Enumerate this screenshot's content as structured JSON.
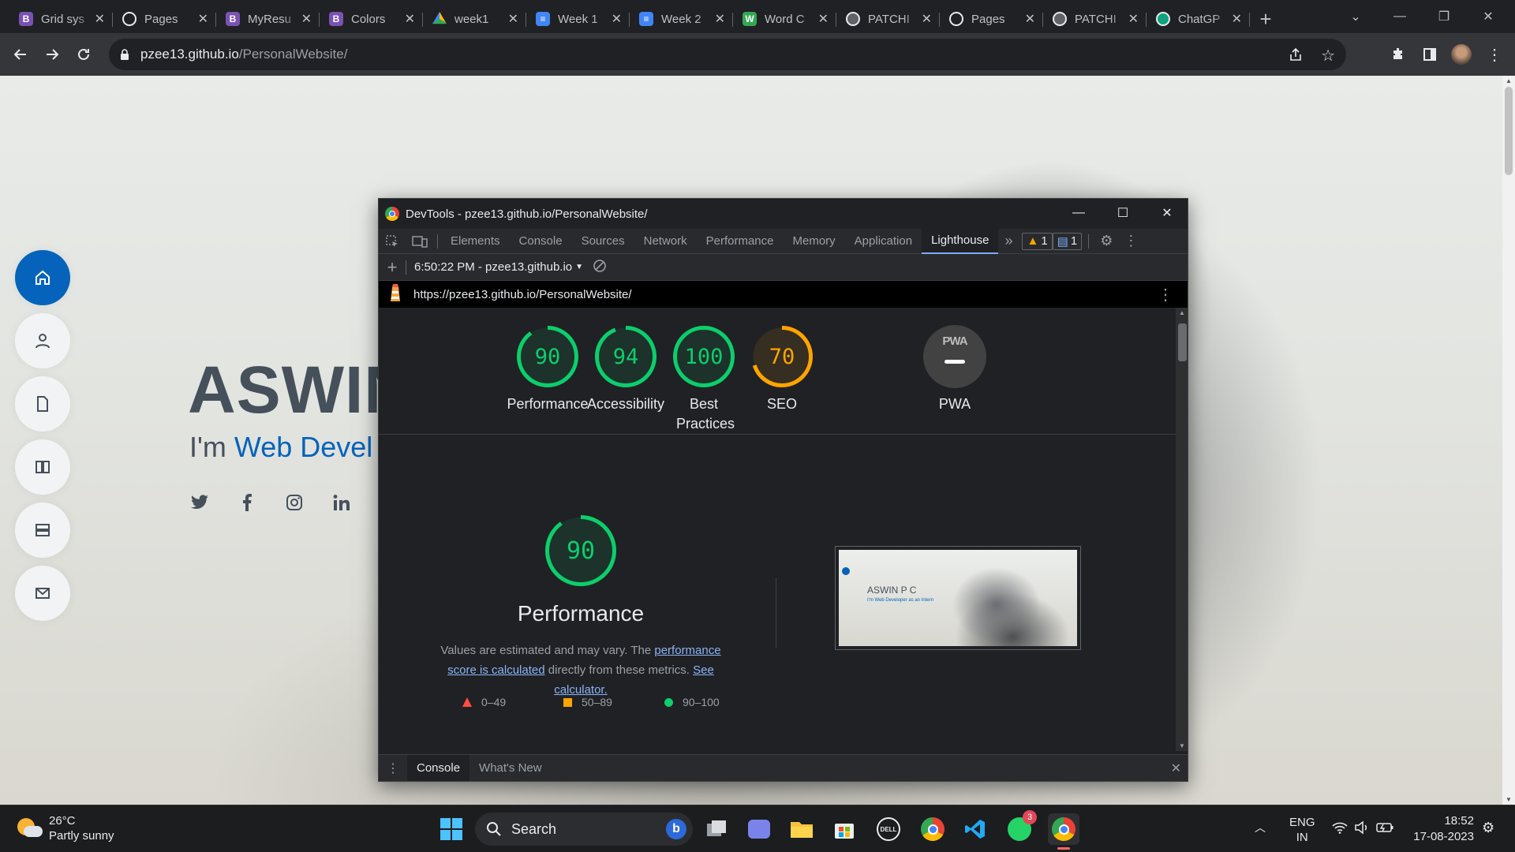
{
  "browser": {
    "tabs": [
      {
        "title": "Grid sys",
        "icon": "bootstrap-icon",
        "fav_color": "#7952b3",
        "fav_text": "B"
      },
      {
        "title": "Pages",
        "icon": "github-icon",
        "fav_color": "#202124",
        "fav_text": ""
      },
      {
        "title": "MyResu",
        "icon": "bootstrap-icon",
        "fav_color": "#7952b3",
        "fav_text": "B"
      },
      {
        "title": "Colors",
        "icon": "bootstrap-icon",
        "fav_color": "#7952b3",
        "fav_text": "B"
      },
      {
        "title": "week1",
        "icon": "google-drive-icon",
        "fav_color": "#202124",
        "fav_text": ""
      },
      {
        "title": "Week 1",
        "icon": "google-docs-icon",
        "fav_color": "#4285f4",
        "fav_text": "≡"
      },
      {
        "title": "Week 2",
        "icon": "google-docs-icon",
        "fav_color": "#4285f4",
        "fav_text": "≡"
      },
      {
        "title": "Word C",
        "icon": "word-counter-icon",
        "fav_color": "#34a853",
        "fav_text": "W"
      },
      {
        "title": "PATCHI",
        "icon": "globe-icon",
        "fav_color": "#5f6368",
        "fav_text": ""
      },
      {
        "title": "Pages",
        "icon": "github-icon",
        "fav_color": "#202124",
        "fav_text": ""
      },
      {
        "title": "PATCHI",
        "icon": "globe-icon",
        "fav_color": "#5f6368",
        "fav_text": ""
      },
      {
        "title": "ChatGP",
        "icon": "chatgpt-icon",
        "fav_color": "#10a37f",
        "fav_text": ""
      }
    ],
    "url_host": "pzee13.github.io",
    "url_path": "/PersonalWebsite/"
  },
  "page": {
    "name": "ASWIN",
    "subtitle_prefix": "I'm ",
    "subtitle_accent": "Web Devel",
    "accent_color": "#0563bb",
    "nav_icons": [
      "home-icon",
      "user-icon",
      "resume-icon",
      "portfolio-icon",
      "services-icon",
      "mail-icon"
    ],
    "social": [
      "twitter-icon",
      "facebook-icon",
      "instagram-icon",
      "linkedin-icon"
    ]
  },
  "devtools": {
    "title": "DevTools - pzee13.github.io/PersonalWebsite/",
    "tabs": [
      "Elements",
      "Console",
      "Sources",
      "Network",
      "Performance",
      "Memory",
      "Application",
      "Lighthouse"
    ],
    "active_tab": "Lighthouse",
    "warnings_count": "1",
    "messages_count": "1",
    "report_selector": "6:50:22 PM - pzee13.github.io",
    "report_url": "https://pzee13.github.io/PersonalWebsite/",
    "drawer_tabs": [
      "Console",
      "What's New"
    ]
  },
  "lighthouse": {
    "scores": [
      {
        "label": "Performance",
        "value": 90,
        "color": "#0cce6b"
      },
      {
        "label": "Accessibility",
        "value": 94,
        "color": "#0cce6b"
      },
      {
        "label": "Best Practices",
        "value": 100,
        "color": "#0cce6b"
      },
      {
        "label": "SEO",
        "value": 70,
        "color": "#ffa400"
      }
    ],
    "pwa_label": "PWA",
    "pwa_badge": "PWA",
    "performance_title": "Performance",
    "performance_score": 90,
    "desc_before": "Values are estimated and may vary. The ",
    "desc_link1": "performance score is calculated",
    "desc_middle": " directly from these metrics. ",
    "desc_link2": "See calculator.",
    "legend": [
      {
        "range": "0–49",
        "color": "#ff4e42",
        "shape": "triangle"
      },
      {
        "range": "50–89",
        "color": "#ffa400",
        "shape": "square"
      },
      {
        "range": "90–100",
        "color": "#0cce6b",
        "shape": "circle"
      }
    ],
    "thumb_name": "ASWIN P C",
    "thumb_sub": "I'm Web Developer as an Intern"
  },
  "taskbar": {
    "temp": "26°C",
    "weather": "Partly sunny",
    "search_label": "Search",
    "lang": "ENG",
    "region": "IN",
    "time": "18:52",
    "date": "17-08-2023",
    "whatsapp_badge": "3"
  }
}
